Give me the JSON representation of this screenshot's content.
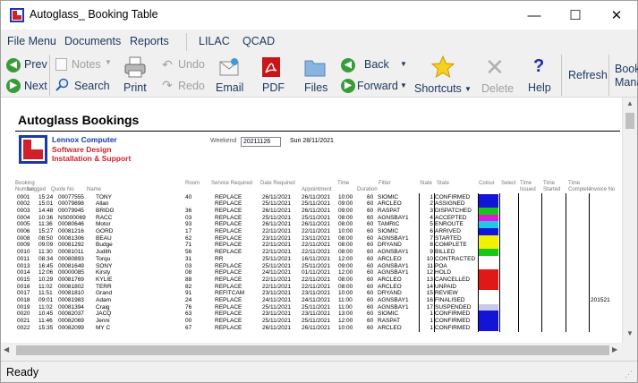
{
  "window": {
    "title": "Autoglass_ Booking Table",
    "min_glyph": "—",
    "max_glyph": "☐",
    "close_glyph": "✕"
  },
  "menu": [
    "File Menu",
    "Documents",
    "Reports",
    "LILAC",
    "QCAD"
  ],
  "toolbar": {
    "prev": "Prev",
    "next": "Next",
    "notes": "Notes",
    "search": "Search",
    "print": "Print",
    "undo": "Undo",
    "redo": "Redo",
    "email": "Email",
    "pdf": "PDF",
    "files": "Files",
    "back": "Back",
    "forward": "Forward",
    "shortcuts": "Shortcuts",
    "delete": "Delete",
    "help": "Help",
    "refresh": "Refresh",
    "booking_mgr_1": "Book",
    "booking_mgr_2": "Mana"
  },
  "document": {
    "title": "Autoglass Bookings",
    "company": {
      "name": "Lennox Computer",
      "line1": "Software Design",
      "line2": "Installation & Support"
    },
    "weekend_label": "Weekend",
    "weekend_value": "20211126",
    "weekend_day": "Sun 28/11/2021",
    "headers": [
      {
        "id": "booking",
        "l1": "Booking",
        "l2": "Number"
      },
      {
        "id": "logged",
        "l1": "",
        "l2": "Logged"
      },
      {
        "id": "quote",
        "l1": "",
        "l2": "Quote No"
      },
      {
        "id": "name",
        "l1": "",
        "l2": "Name"
      },
      {
        "id": "room",
        "l1": "Room",
        "l2": ""
      },
      {
        "id": "service",
        "l1": "Service Required",
        "l2": ""
      },
      {
        "id": "datereq",
        "l1": "Date Required",
        "l2": ""
      },
      {
        "id": "appt",
        "l1": "",
        "l2": "Appointment"
      },
      {
        "id": "time",
        "l1": "Time",
        "l2": ""
      },
      {
        "id": "duration",
        "l1": "",
        "l2": "Duration"
      },
      {
        "id": "fitter",
        "l1": "Fitter",
        "l2": ""
      },
      {
        "id": "state",
        "l1": "State",
        "l2": ""
      },
      {
        "id": "state2",
        "l1": "State",
        "l2": ""
      },
      {
        "id": "colour",
        "l1": "Colour",
        "l2": ""
      },
      {
        "id": "select",
        "l1": "Select",
        "l2": ""
      },
      {
        "id": "time2",
        "l1": "Time",
        "l2": "Issued"
      },
      {
        "id": "time3",
        "l1": "Time",
        "l2": "Started"
      },
      {
        "id": "time4",
        "l1": "Time",
        "l2": "Complete"
      },
      {
        "id": "invoice",
        "l1": "",
        "l2": "Invoice No"
      }
    ],
    "rows": [
      {
        "num": "0001",
        "logged": "15:24",
        "quote": "00077555",
        "name": "TONY",
        "room": "40",
        "service": "REPLACE",
        "datereq": "26/11/2021",
        "appt": "26/11/2021",
        "time": "10:00",
        "dur": "60",
        "fitter": "SIOMIC",
        "state": "1",
        "status": "CONFIRMED",
        "color": "#1414d8",
        "invoice": ""
      },
      {
        "num": "0002",
        "logged": "15:01",
        "quote": "00079898",
        "name": "Allan",
        "room": "",
        "service": "REPLACE",
        "datereq": "25/11/2021",
        "appt": "25/11/2021",
        "time": "09:00",
        "dur": "60",
        "fitter": "ARCLEO",
        "state": "2",
        "status": "ASSIGNED",
        "color": "#1414d8",
        "invoice": ""
      },
      {
        "num": "0003",
        "logged": "14:48",
        "quote": "00079945",
        "name": "BRIDG",
        "room": "36",
        "service": "REPLACE",
        "datereq": "26/11/2021",
        "appt": "26/11/2021",
        "time": "09:00",
        "dur": "60",
        "fitter": "RASPAT",
        "state": "3",
        "status": "DISPATCHED",
        "color": "#18c818",
        "invoice": ""
      },
      {
        "num": "0004",
        "logged": "10:36",
        "quote": "NS000069",
        "name": "RACC",
        "room": "03",
        "service": "REPLACE",
        "datereq": "25/11/2021",
        "appt": "25/11/2021",
        "time": "08:00",
        "dur": "60",
        "fitter": "AGNSBAY1",
        "state": "4",
        "status": "ACCEPTED",
        "color": "#e018e0",
        "invoice": ""
      },
      {
        "num": "0005",
        "logged": "11:36",
        "quote": "00080646",
        "name": "Motor",
        "room": "93",
        "service": "REPLACE",
        "datereq": "26/11/2021",
        "appt": "26/11/2021",
        "time": "08:00",
        "dur": "60",
        "fitter": "TAMRIC",
        "state": "5",
        "status": "ENROUTE",
        "color": "#1ec8e8",
        "invoice": ""
      },
      {
        "num": "0006",
        "logged": "15:27",
        "quote": "00081216",
        "name": "GORD",
        "room": "17",
        "service": "REPLACE",
        "datereq": "22/11/2021",
        "appt": "22/11/2021",
        "time": "10:00",
        "dur": "60",
        "fitter": "SIOMIC",
        "state": "6",
        "status": "ARRIVED",
        "color": "#1414d8",
        "invoice": ""
      },
      {
        "num": "0008",
        "logged": "08:50",
        "quote": "00081306",
        "name": "BEAU",
        "room": "62",
        "service": "REPLACE",
        "datereq": "23/11/2021",
        "appt": "23/11/2021",
        "time": "08:00",
        "dur": "60",
        "fitter": "AGNSBAY1",
        "state": "7",
        "status": "STARTED",
        "color": "#f0f000",
        "invoice": ""
      },
      {
        "num": "0009",
        "logged": "09:09",
        "quote": "00081292",
        "name": "Budge",
        "room": "71",
        "service": "REPLACE",
        "datereq": "22/11/2021",
        "appt": "22/11/2021",
        "time": "08:00",
        "dur": "60",
        "fitter": "DRYAND",
        "state": "8",
        "status": "COMPLETE",
        "color": "#f0f000",
        "invoice": ""
      },
      {
        "num": "0010",
        "logged": "11:30",
        "quote": "00081011",
        "name": "Judith",
        "room": "56",
        "service": "REPLACE",
        "datereq": "22/11/2021",
        "appt": "22/11/2021",
        "time": "08:00",
        "dur": "60",
        "fitter": "AGNSBAY1",
        "state": "9",
        "status": "BILLED",
        "color": "#18c818",
        "invoice": ""
      },
      {
        "num": "0011",
        "logged": "08:34",
        "quote": "00080893",
        "name": "Torqu",
        "room": "31",
        "service": "RR",
        "datereq": "25/11/2021",
        "appt": "16/11/2021",
        "time": "12:00",
        "dur": "60",
        "fitter": "ARCLEO",
        "state": "10",
        "status": "CONTRACTED",
        "color": "#ffffff",
        "invoice": ""
      },
      {
        "num": "0013",
        "logged": "16:45",
        "quote": "00081649",
        "name": "SONY",
        "room": "03",
        "service": "REPLACE",
        "datereq": "25/11/2021",
        "appt": "25/11/2021",
        "time": "09:00",
        "dur": "60",
        "fitter": "AGNSBAY1",
        "state": "11",
        "status": "POA",
        "color": "#ffffff",
        "invoice": ""
      },
      {
        "num": "0014",
        "logged": "12:06",
        "quote": "00000085",
        "name": "Kirsty",
        "room": "08",
        "service": "REPLACE",
        "datereq": "24/11/2021",
        "appt": "01/11/2021",
        "time": "12:00",
        "dur": "60",
        "fitter": "AGNSBAY1",
        "state": "12",
        "status": "HOLD",
        "color": "#e01818",
        "invoice": ""
      },
      {
        "num": "0015",
        "logged": "10:29",
        "quote": "00081769",
        "name": "KYLIE",
        "room": "88",
        "service": "REPLACE",
        "datereq": "22/11/2021",
        "appt": "22/11/2021",
        "time": "08:00",
        "dur": "60",
        "fitter": "ARCLEO",
        "state": "13",
        "status": "CANCELLED",
        "color": "#e01818",
        "invoice": ""
      },
      {
        "num": "0016",
        "logged": "11:02",
        "quote": "00081802",
        "name": "TERR",
        "room": "82",
        "service": "REPLACE",
        "datereq": "22/11/2021",
        "appt": "22/11/2021",
        "time": "08:00",
        "dur": "60",
        "fitter": "ARCLEO",
        "state": "14",
        "status": "UNPAID",
        "color": "#e01818",
        "invoice": ""
      },
      {
        "num": "0017",
        "logged": "11:51",
        "quote": "00081810",
        "name": "Grand",
        "room": "91",
        "service": "REFITCAM",
        "datereq": "23/11/2021",
        "appt": "23/11/2021",
        "time": "10:00",
        "dur": "60",
        "fitter": "DRYAND",
        "state": "15",
        "status": "REVIEW",
        "color": "#ffffff",
        "invoice": ""
      },
      {
        "num": "0018",
        "logged": "09:01",
        "quote": "00081983",
        "name": "Adam",
        "room": "24",
        "service": "REPLACE",
        "datereq": "24/11/2021",
        "appt": "24/11/2021",
        "time": "11:00",
        "dur": "60",
        "fitter": "AGNSBAY1",
        "state": "16",
        "status": "FINALISED",
        "color": "#ffffff",
        "invoice": "201521"
      },
      {
        "num": "0019",
        "logged": "11:02",
        "quote": "00081394",
        "name": "Craig",
        "room": "76",
        "service": "REPLACE",
        "datereq": "25/11/2021",
        "appt": "25/11/2021",
        "time": "11:00",
        "dur": "60",
        "fitter": "AGNSBAY1",
        "state": "17",
        "status": "SUSPENDED",
        "color": "#c8c8e8",
        "invoice": ""
      },
      {
        "num": "0020",
        "logged": "10:45",
        "quote": "00082037",
        "name": "JACQ",
        "room": "63",
        "service": "REPLACE",
        "datereq": "23/11/2021",
        "appt": "23/11/2021",
        "time": "13:00",
        "dur": "60",
        "fitter": "SIOMIC",
        "state": "1",
        "status": "CONFIRMED",
        "color": "#1414d8",
        "invoice": ""
      },
      {
        "num": "0021",
        "logged": "11:46",
        "quote": "00082069",
        "name": "Jenni",
        "room": "00",
        "service": "REPLACE",
        "datereq": "25/11/2021",
        "appt": "25/11/2021",
        "time": "12:00",
        "dur": "60",
        "fitter": "RASPAT",
        "state": "1",
        "status": "CONFIRMED",
        "color": "#1414d8",
        "invoice": ""
      },
      {
        "num": "0022",
        "logged": "15:35",
        "quote": "00082099",
        "name": "MY C",
        "room": "67",
        "service": "REPLACE",
        "datereq": "26/11/2021",
        "appt": "26/11/2021",
        "time": "10:00",
        "dur": "60",
        "fitter": "ARCLEO",
        "state": "1",
        "status": "CONFIRMED",
        "color": "#1414d8",
        "invoice": ""
      }
    ]
  },
  "status": "Ready"
}
